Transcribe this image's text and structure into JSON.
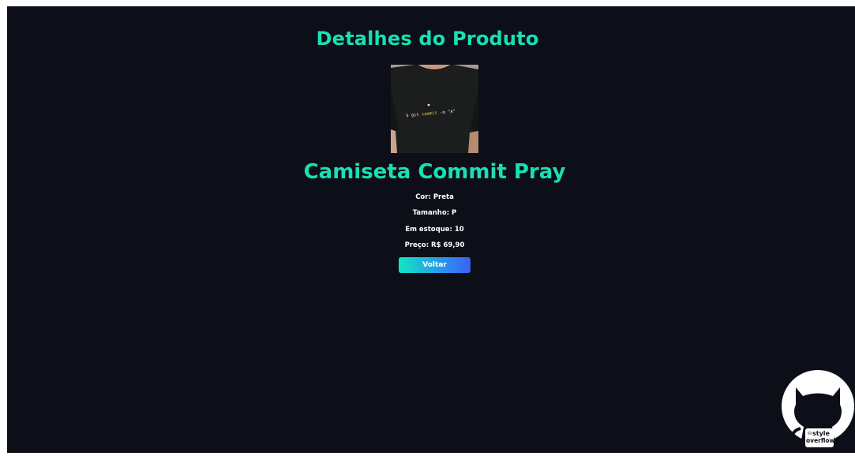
{
  "page": {
    "title": "Detalhes do Produto"
  },
  "product": {
    "image_alt": "Camiseta Commit Pray",
    "shirt_print": {
      "prefix": "$ git ",
      "command": "commit",
      "suffix": " -m \"A\""
    },
    "name": "Camiseta Commit Pray",
    "color": "Cor: Preta",
    "size": "Tamanho: P",
    "stock": "Em estoque: 10",
    "price": "Preço: R$ 69,90"
  },
  "actions": {
    "back_label": "Voltar"
  },
  "badge": {
    "line1": "style",
    "line2": "overflow"
  },
  "colors": {
    "background": "#0c0f18",
    "accent": "#19e0b4",
    "button_gradient_start": "#12e6c2",
    "button_gradient_end": "#3f5ff5"
  }
}
